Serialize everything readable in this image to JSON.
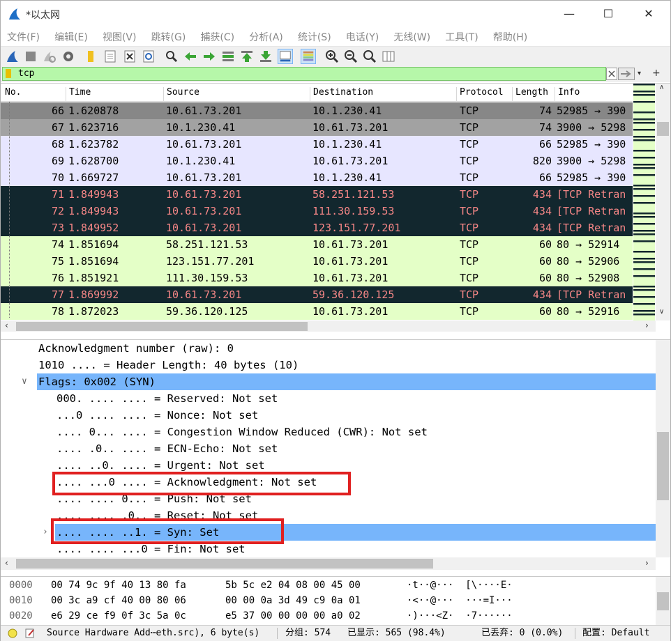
{
  "window": {
    "title": "*以太网"
  },
  "menu": [
    "文件(F)",
    "编辑(E)",
    "视图(V)",
    "跳转(G)",
    "捕获(C)",
    "分析(A)",
    "统计(S)",
    "电话(Y)",
    "无线(W)",
    "工具(T)",
    "帮助(H)"
  ],
  "toolbar_icons": [
    "shark-fin-start-icon",
    "stop-icon",
    "restart-icon",
    "capture-options-icon",
    "open-file-icon",
    "file-save-icon",
    "close-file-icon",
    "reload-icon",
    "find-packet-icon",
    "go-back-icon",
    "go-forward-icon",
    "go-to-packet-icon",
    "go-first-icon",
    "go-last-icon",
    "autoscroll-icon",
    "colorize-icon",
    "zoom-in-icon",
    "zoom-out-icon",
    "zoom-normal-icon",
    "resize-columns-icon"
  ],
  "filter": {
    "value": "tcp"
  },
  "columns": [
    "No.",
    "Time",
    "Source",
    "Destination",
    "Protocol",
    "Length",
    "Info"
  ],
  "packets": [
    {
      "no": "66",
      "time": "1.620878",
      "src": "10.61.73.201",
      "dst": "10.1.230.41",
      "proto": "TCP",
      "len": "74",
      "info": "52985 → 390",
      "bg": "#878787",
      "fg": "#000000"
    },
    {
      "no": "67",
      "time": "1.623716",
      "src": "10.1.230.41",
      "dst": "10.61.73.201",
      "proto": "TCP",
      "len": "74",
      "info": "3900 → 5298",
      "bg": "#a2a2a2",
      "fg": "#000000"
    },
    {
      "no": "68",
      "time": "1.623782",
      "src": "10.61.73.201",
      "dst": "10.1.230.41",
      "proto": "TCP",
      "len": "66",
      "info": "52985 → 390",
      "bg": "#e7e6ff",
      "fg": "#000000"
    },
    {
      "no": "69",
      "time": "1.628700",
      "src": "10.1.230.41",
      "dst": "10.61.73.201",
      "proto": "TCP",
      "len": "820",
      "info": "3900 → 5298",
      "bg": "#e7e6ff",
      "fg": "#000000"
    },
    {
      "no": "70",
      "time": "1.669727",
      "src": "10.61.73.201",
      "dst": "10.1.230.41",
      "proto": "TCP",
      "len": "66",
      "info": "52985 → 390",
      "bg": "#e7e6ff",
      "fg": "#000000"
    },
    {
      "no": "71",
      "time": "1.849943",
      "src": "10.61.73.201",
      "dst": "58.251.121.53",
      "proto": "TCP",
      "len": "434",
      "info": "[TCP Retran",
      "bg": "#12272e",
      "fg": "#f78787"
    },
    {
      "no": "72",
      "time": "1.849943",
      "src": "10.61.73.201",
      "dst": "111.30.159.53",
      "proto": "TCP",
      "len": "434",
      "info": "[TCP Retran",
      "bg": "#12272e",
      "fg": "#f78787"
    },
    {
      "no": "73",
      "time": "1.849952",
      "src": "10.61.73.201",
      "dst": "123.151.77.201",
      "proto": "TCP",
      "len": "434",
      "info": "[TCP Retran",
      "bg": "#12272e",
      "fg": "#f78787"
    },
    {
      "no": "74",
      "time": "1.851694",
      "src": "58.251.121.53",
      "dst": "10.61.73.201",
      "proto": "TCP",
      "len": "60",
      "info": "80 → 52914",
      "bg": "#e4ffc7",
      "fg": "#000000"
    },
    {
      "no": "75",
      "time": "1.851694",
      "src": "123.151.77.201",
      "dst": "10.61.73.201",
      "proto": "TCP",
      "len": "60",
      "info": "80 → 52906",
      "bg": "#e4ffc7",
      "fg": "#000000"
    },
    {
      "no": "76",
      "time": "1.851921",
      "src": "111.30.159.53",
      "dst": "10.61.73.201",
      "proto": "TCP",
      "len": "60",
      "info": "80 → 52908",
      "bg": "#e4ffc7",
      "fg": "#000000"
    },
    {
      "no": "77",
      "time": "1.869992",
      "src": "10.61.73.201",
      "dst": "59.36.120.125",
      "proto": "TCP",
      "len": "434",
      "info": "[TCP Retran",
      "bg": "#12272e",
      "fg": "#f78787"
    },
    {
      "no": "78",
      "time": "1.872023",
      "src": "59.36.120.125",
      "dst": "10.61.73.201",
      "proto": "TCP",
      "len": "60",
      "info": "80 → 52916",
      "bg": "#e4ffc7",
      "fg": "#000000"
    }
  ],
  "details": [
    {
      "text": "Acknowledgment number (raw): 0",
      "arrow": "",
      "selected": false
    },
    {
      "text": "1010 .... = Header Length: 40 bytes (10)",
      "arrow": "",
      "selected": false
    },
    {
      "text": "Flags: 0x002 (SYN)",
      "arrow": "∨",
      "selected": true
    },
    {
      "text": "000. .... .... = Reserved: Not set",
      "arrow": "",
      "selected": false
    },
    {
      "text": "...0 .... .... = Nonce: Not set",
      "arrow": "",
      "selected": false
    },
    {
      "text": ".... 0... .... = Congestion Window Reduced (CWR): Not set",
      "arrow": "",
      "selected": false
    },
    {
      "text": ".... .0.. .... = ECN-Echo: Not set",
      "arrow": "",
      "selected": false
    },
    {
      "text": ".... ..0. .... = Urgent: Not set",
      "arrow": "",
      "selected": false
    },
    {
      "text": ".... ...0 .... = Acknowledgment: Not set",
      "arrow": "",
      "selected": false
    },
    {
      "text": ".... .... 0... = Push: Not set",
      "arrow": "",
      "selected": false
    },
    {
      "text": ".... .... .0.. = Reset: Not set",
      "arrow": "",
      "selected": false
    },
    {
      "text": ".... .... ..1. = Syn: Set",
      "arrow": "›",
      "selected": true
    },
    {
      "text": ".... .... ...0 = Fin: Not set",
      "arrow": "",
      "selected": false
    }
  ],
  "hex": [
    {
      "offset": "0000",
      "bytes1": "00 74 9c 9f 40 13 80 fa",
      "bytes2": "5b 5c e2 04 08 00 45 00",
      "ascii": "·t··@···  [\\····E·"
    },
    {
      "offset": "0010",
      "bytes1": "00 3c a9 cf 40 00 80 06",
      "bytes2": "00 00 0a 3d 49 c9 0a 01",
      "ascii": "·<··@···  ···=I···"
    },
    {
      "offset": "0020",
      "bytes1": "e6 29 ce f9 0f 3c 5a 0c",
      "bytes2": "e5 37 00 00 00 00 a0 02",
      "ascii": "·)···<Z·  ·7······"
    }
  ],
  "status": {
    "field": "Source Hardware Add⋯eth.src), 6 byte(s)",
    "groups": "分组: 574",
    "displayed": "已显示: 565 (98.4%)",
    "dropped": "已丢弃: 0 (0.0%)",
    "profile": "配置: Default"
  },
  "colors": {
    "accent": "#7ab4f5",
    "selection": "#77b5fb",
    "highlight_box": "#e02020",
    "filter_ok": "#b6f7a9"
  }
}
